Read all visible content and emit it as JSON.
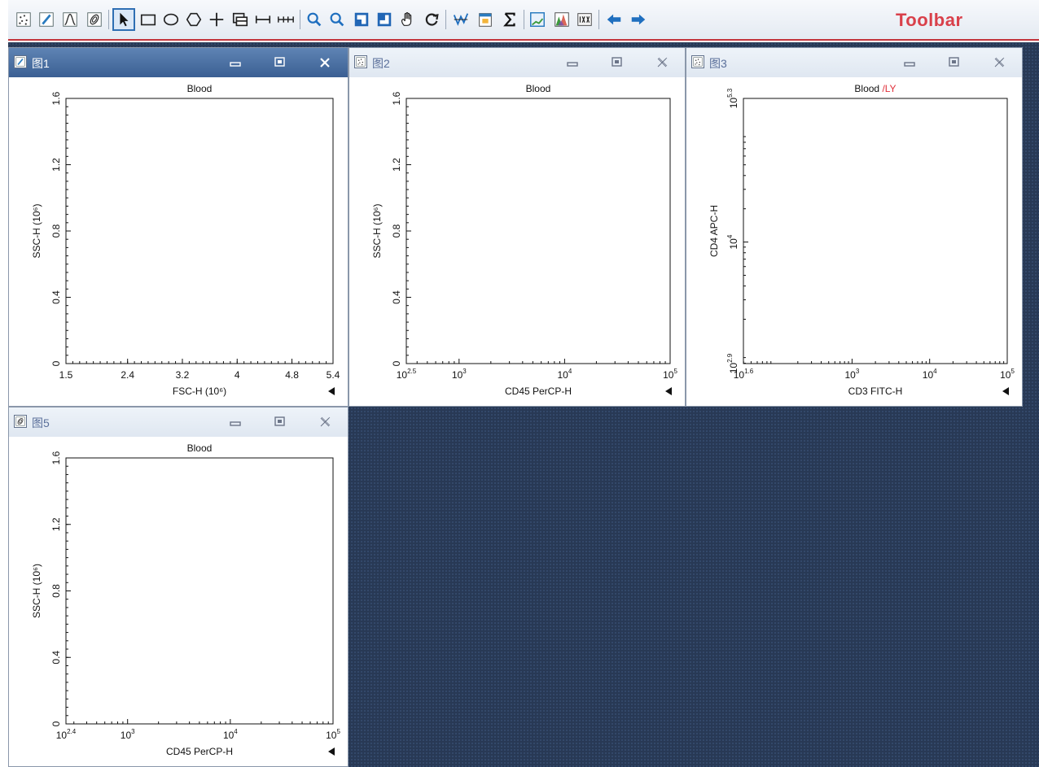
{
  "toolbar": {
    "label": "Toolbar",
    "buttons": [
      {
        "name": "dot-plot-tool-button",
        "icon": "dot-plot-icon"
      },
      {
        "name": "density-plot-tool-button",
        "icon": "density-plot-icon"
      },
      {
        "name": "histogram-tool-button",
        "icon": "histogram-icon"
      },
      {
        "name": "contour-plot-tool-button",
        "icon": "contour-plot-icon"
      },
      {
        "name": "pointer-tool-button",
        "icon": "pointer-icon",
        "selected": true
      },
      {
        "name": "rectangle-gate-button",
        "icon": "rectangle-icon"
      },
      {
        "name": "ellipse-gate-button",
        "icon": "ellipse-icon"
      },
      {
        "name": "polygon-gate-button",
        "icon": "polygon-icon"
      },
      {
        "name": "quadrant-gate-button",
        "icon": "crosshair-icon"
      },
      {
        "name": "overlay-button",
        "icon": "overlay-icon"
      },
      {
        "name": "interval-gate-button",
        "icon": "interval-icon"
      },
      {
        "name": "multi-interval-gate-button",
        "icon": "multi-interval-icon"
      },
      {
        "name": "zoom-in-button",
        "icon": "zoom-in-icon"
      },
      {
        "name": "zoom-out-button",
        "icon": "zoom-out-icon"
      },
      {
        "name": "restore-view-button",
        "icon": "restore-icon"
      },
      {
        "name": "maximize-view-button",
        "icon": "maximize-icon"
      },
      {
        "name": "pan-button",
        "icon": "hand-icon"
      },
      {
        "name": "refresh-button",
        "icon": "refresh-icon"
      },
      {
        "name": "compensation-button",
        "icon": "compensation-icon"
      },
      {
        "name": "report-button",
        "icon": "report-icon"
      },
      {
        "name": "statistics-button",
        "icon": "sigma-icon"
      },
      {
        "name": "chart-button",
        "icon": "chart-icon"
      },
      {
        "name": "multi-histogram-button",
        "icon": "multi-histogram-icon"
      },
      {
        "name": "batch-button",
        "icon": "batch-icon"
      },
      {
        "name": "back-button",
        "icon": "arrow-left-icon"
      },
      {
        "name": "forward-button",
        "icon": "arrow-right-icon"
      }
    ]
  },
  "windows": [
    {
      "title": "图1",
      "icon": "density-plot-icon",
      "active": true,
      "chart_data": {
        "type": "scatter",
        "series": [],
        "title": "Blood",
        "xlabel": "FSC-H (10⁶)",
        "ylabel": "SSC-H (10⁶)",
        "x_scale": "linear",
        "xlim": [
          1.5,
          5.4
        ],
        "x_ticks": [
          1.5,
          2.4,
          3.2,
          4,
          4.8,
          5.4
        ],
        "x_tick_labels": [
          "1.5",
          "2.4",
          "3.2",
          "4",
          "4.8",
          "5.4"
        ],
        "y_scale": "linear",
        "ylim": [
          0,
          1.6
        ],
        "y_ticks": [
          0,
          0.4,
          0.8,
          1.2,
          1.6
        ],
        "y_tick_labels": [
          "0",
          "0.4",
          "0.8",
          "1.2",
          "1.6"
        ]
      }
    },
    {
      "title": "图2",
      "icon": "dot-plot-icon",
      "active": false,
      "chart_data": {
        "type": "scatter",
        "series": [],
        "title": "Blood",
        "xlabel": "CD45 PerCP-H",
        "ylabel": "SSC-H (10⁶)",
        "x_scale": "log",
        "xlim": [
          2.5,
          5
        ],
        "x_ticks": [
          2.5,
          3,
          4,
          5
        ],
        "x_tick_labels": [
          [
            "10",
            "2.5"
          ],
          [
            "10",
            "3"
          ],
          [
            "10",
            "4"
          ],
          [
            "10",
            "5"
          ]
        ],
        "y_scale": "linear",
        "ylim": [
          0,
          1.6
        ],
        "y_ticks": [
          0,
          0.4,
          0.8,
          1.2,
          1.6
        ],
        "y_tick_labels": [
          "0",
          "0.4",
          "0.8",
          "1.2",
          "1.6"
        ]
      }
    },
    {
      "title": "图3",
      "icon": "dot-plot-icon",
      "active": false,
      "chart_data": {
        "type": "scatter",
        "series": [],
        "title": "Blood",
        "title_suffix": "LY",
        "xlabel": "CD3 FITC-H",
        "ylabel": "CD4 APC-H",
        "x_scale": "log",
        "xlim": [
          1.6,
          5
        ],
        "x_ticks": [
          1.6,
          3,
          4,
          5
        ],
        "x_tick_labels": [
          [
            "10",
            "1.6"
          ],
          [
            "10",
            "3"
          ],
          [
            "10",
            "4"
          ],
          [
            "10",
            "5"
          ]
        ],
        "y_scale": "log",
        "ylim": [
          2.9,
          5.3
        ],
        "y_ticks": [
          2.9,
          4,
          5.3
        ],
        "y_tick_labels": [
          [
            "10",
            "2.9"
          ],
          [
            "10",
            "4"
          ],
          [
            "10",
            "5.3"
          ]
        ]
      }
    },
    {
      "title": "图5",
      "icon": "contour-plot-icon",
      "active": false,
      "chart_data": {
        "type": "scatter",
        "series": [],
        "title": "Blood",
        "xlabel": "CD45 PerCP-H",
        "ylabel": "SSC-H (10⁶)",
        "x_scale": "log",
        "xlim": [
          2.4,
          5
        ],
        "x_ticks": [
          2.4,
          3,
          4,
          5
        ],
        "x_tick_labels": [
          [
            "10",
            "2.4"
          ],
          [
            "10",
            "3"
          ],
          [
            "10",
            "4"
          ],
          [
            "10",
            "5"
          ]
        ],
        "y_scale": "linear",
        "ylim": [
          0,
          1.6
        ],
        "y_ticks": [
          0,
          0.4,
          0.8,
          1.2,
          1.6
        ],
        "y_tick_labels": [
          "0",
          "0.4",
          "0.8",
          "1.2",
          "1.6"
        ]
      }
    }
  ],
  "colors": {
    "accent": "#d9404a",
    "workspace": "#283955",
    "active_titlebar": "#4a6fa3",
    "title_highlight": "#e0303a"
  }
}
